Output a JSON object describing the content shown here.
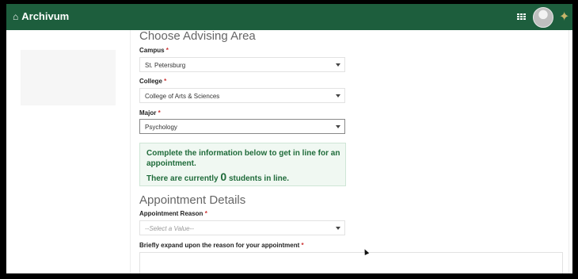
{
  "app": {
    "title": "Archivum"
  },
  "icons": {
    "home": "home-icon",
    "apps": "apps-grid-icon",
    "avatar": "user-avatar",
    "logo": "bull-logo-icon"
  },
  "colors": {
    "topbar": "#1d5e3d",
    "alert_text": "#1f6b3a",
    "required": "#cc3333"
  },
  "advising": {
    "title": "Choose Advising Area",
    "campus": {
      "label": "Campus",
      "value": "St. Petersburg"
    },
    "college": {
      "label": "College",
      "value": "College of Arts & Sciences"
    },
    "major": {
      "label": "Major",
      "value": "Psychology"
    },
    "required_mark": "*"
  },
  "alert": {
    "line1": "Complete the information below to get in line for an appointment.",
    "line2_prefix": "There are currently",
    "count": "0",
    "line2_suffix": "students in line."
  },
  "appointment": {
    "title": "Appointment Details",
    "reason": {
      "label": "Appointment Reason",
      "placeholder": "--Select a Value--"
    },
    "expand_label": "Briefly expand upon the reason for your appointment"
  }
}
